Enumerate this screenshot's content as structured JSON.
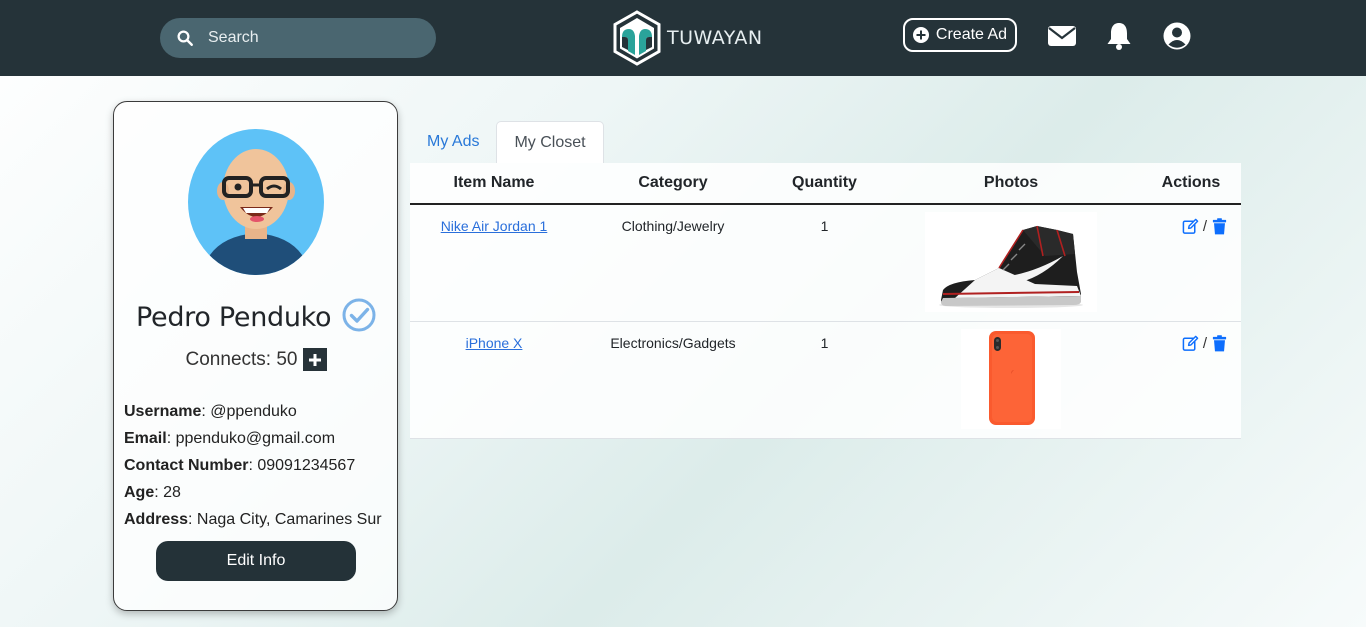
{
  "navbar": {
    "search_placeholder": "Search",
    "brand_name": "TUWAYAN",
    "create_ad_label": "Create Ad",
    "icons": [
      "search-icon",
      "envelope-icon",
      "bell-icon",
      "user-circle-icon"
    ]
  },
  "profile": {
    "name": "Pedro Penduko",
    "connects_label": "Connects: 50",
    "fields": [
      {
        "label": "Username",
        "value": ": @ppenduko"
      },
      {
        "label": "Email",
        "value": ": ppenduko@gmail.com"
      },
      {
        "label": "Contact Number",
        "value": ": 09091234567"
      },
      {
        "label": "Age",
        "value": ": 28"
      },
      {
        "label": "Address",
        "value": ": Naga City, Camarines Sur"
      }
    ],
    "edit_label": "Edit Info"
  },
  "tabs": [
    {
      "label": "My Ads",
      "active": false
    },
    {
      "label": "My Closet",
      "active": true
    }
  ],
  "table": {
    "headers": [
      "Item Name",
      "Category",
      "Quantity",
      "Photos",
      "Actions"
    ],
    "rows": [
      {
        "name": "Nike Air Jordan 1",
        "category": "Clothing/Jewelry",
        "quantity": "1",
        "slash": "/"
      },
      {
        "name": "iPhone X",
        "category": "Electronics/Gadgets",
        "quantity": "1",
        "slash": "/"
      }
    ]
  },
  "colors": {
    "navbar": "#253339",
    "search_bg": "#4a6670",
    "accent_blue": "#2a6fdb",
    "button_dark": "#243238",
    "avatar_bg": "#5ec2f7"
  }
}
